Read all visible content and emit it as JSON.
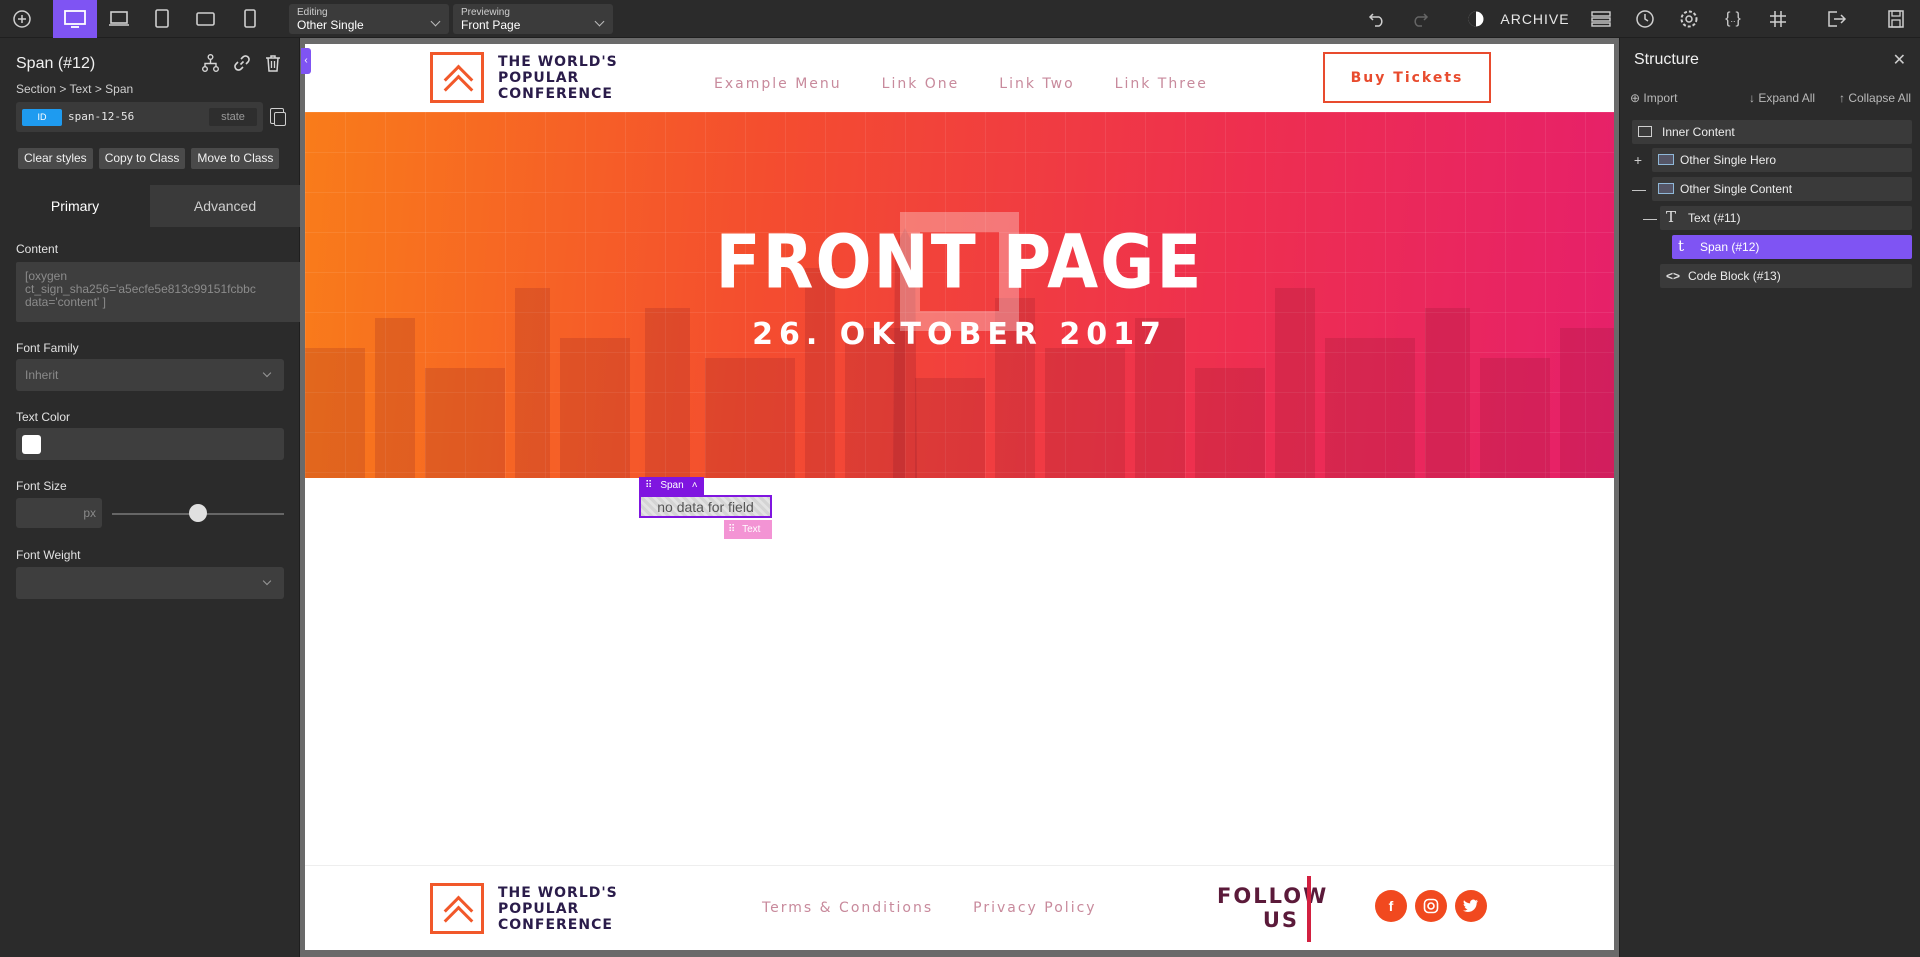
{
  "topbar": {
    "editing_caption": "Editing",
    "editing_value": "Other Single",
    "previewing_caption": "Previewing",
    "previewing_value": "Front Page",
    "archive_label": "ARCHIVE"
  },
  "leftpanel": {
    "title": "Span (#12)",
    "breadcrumb": "Section > Text > Span",
    "id_badge": "ID",
    "id_value": "span-12-56",
    "state_label": "state",
    "buttons": [
      "Clear styles",
      "Copy to Class",
      "Move to Class"
    ],
    "tabs": [
      "Primary",
      "Advanced"
    ],
    "content_label": "Content",
    "content_value": "[oxygen\nct_sign_sha256='a5ecfe5e813c99151fcbbc\ndata='content' ]",
    "font_family_label": "Font Family",
    "font_family_value": "Inherit",
    "text_color_label": "Text Color",
    "text_color_value": "#ffffff",
    "font_size_label": "Font Size",
    "font_size_unit": "px",
    "font_weight_label": "Font Weight"
  },
  "site": {
    "logo_text": "THE WORLD'S\nPOPULAR\nCONFERENCE",
    "nav": [
      "Example Menu",
      "Link One",
      "Link Two",
      "Link Three"
    ],
    "buy_button": "Buy Tickets",
    "hero_title": "FRONT PAGE",
    "hero_date": "26. OKTOBER 2017",
    "span_tag": "Span",
    "span_placeholder": "no data for field",
    "text_tag": "Text",
    "footer_links": [
      "Terms & Conditions",
      "Privacy Policy"
    ],
    "follow_text": "FOLLOW\nUS",
    "social_icons": [
      "facebook-icon",
      "instagram-icon",
      "twitter-icon"
    ]
  },
  "rightpanel": {
    "title": "Structure",
    "import_label": "Import",
    "expand_label": "Expand All",
    "collapse_label": "Collapse All",
    "tree": [
      {
        "label": "Inner Content",
        "icon": "section-icon",
        "toggle": ""
      },
      {
        "label": "Other Single Hero",
        "icon": "div-icon",
        "toggle": "+"
      },
      {
        "label": "Other Single Content",
        "icon": "div-icon",
        "toggle": "—"
      },
      {
        "label": "Text (#11)",
        "icon": "text-icon",
        "toggle": "—"
      },
      {
        "label": "Span (#12)",
        "icon": "span-icon",
        "toggle": "",
        "selected": true
      },
      {
        "label": "Code Block (#13)",
        "icon": "code-icon",
        "toggle": ""
      }
    ]
  },
  "colors": {
    "accent": "#7f54f3",
    "brand_orange": "#f1582a",
    "id_badge": "#1e9bf0"
  }
}
